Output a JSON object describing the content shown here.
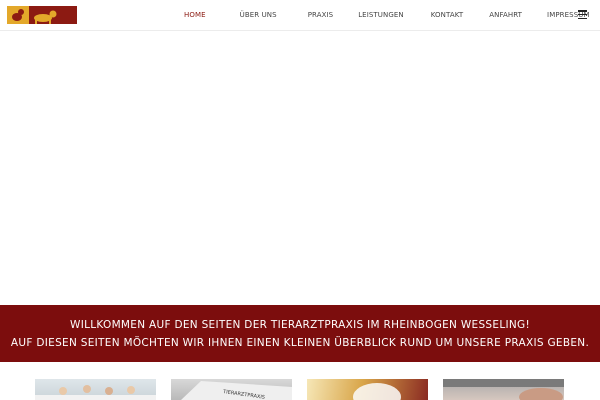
{
  "nav": {
    "items": [
      {
        "label": "HOME",
        "active": true
      },
      {
        "label": "ÜBER UNS",
        "active": false
      },
      {
        "label": "PRAXIS",
        "active": false
      },
      {
        "label": "LEISTUNGEN",
        "active": false
      },
      {
        "label": "KONTAKT",
        "active": false
      },
      {
        "label": "ANFAHRT",
        "active": false
      },
      {
        "label": "IMPRESSUM",
        "active": false
      }
    ],
    "menu_icon": "hamburger-menu-icon"
  },
  "banner": {
    "line1": "WILLKOMMEN AUF DEN SEITEN DER TIERARZTPRAXIS IM RHEINBOGEN WESSELING!",
    "line2": "AUF DIESEN SEITEN MÖCHTEN WIR IHNEN EINEN KLEINEN ÜBERBLICK RUND UM UNSERE PRAXIS GEBEN."
  },
  "colors": {
    "brand_red": "#7c0d0d",
    "nav_active": "#8b1a12",
    "logo_gold": "#e3a82a"
  }
}
